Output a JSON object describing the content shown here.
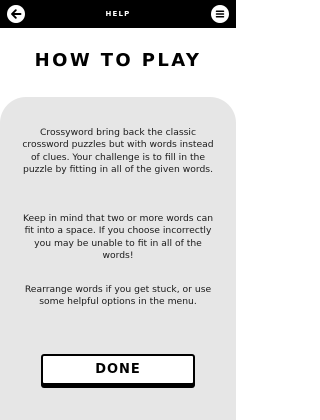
{
  "header": {
    "title": "HELP",
    "back_icon": "arrow-left-icon",
    "menu_icon": "hamburger-menu-icon",
    "background": "#000000"
  },
  "page": {
    "title": "HOW TO PLAY",
    "panel_color": "#e6e6e6"
  },
  "content": {
    "paragraphs": [
      "Crossyword bring back the classic crossword puzzles but with words instead of clues. Your challenge is to fill in the puzzle by fitting in all of the given words.",
      "Keep in mind that two or more words can fit into a space. If you choose incorrectly you may be unable to fit in all of the words!",
      "Rearrange words if you get stuck, or use some helpful options in the menu."
    ]
  },
  "actions": {
    "done_label": "DONE"
  }
}
